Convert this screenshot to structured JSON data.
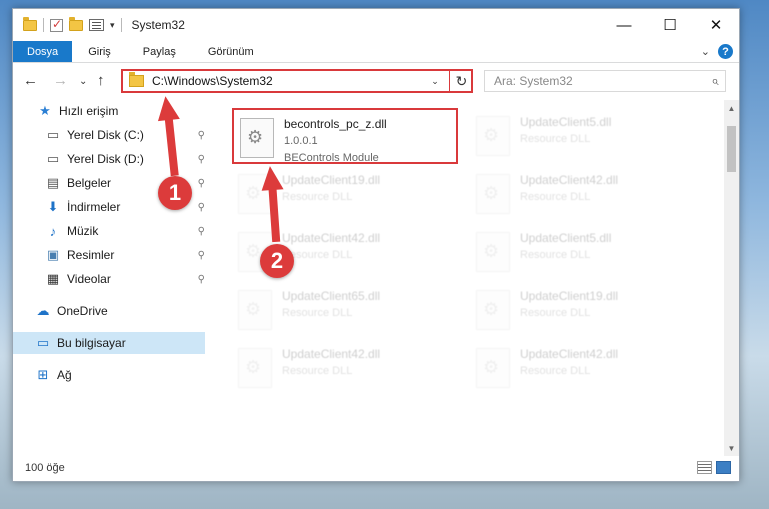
{
  "window": {
    "title": "System32",
    "controls": {
      "minimize": "—",
      "maximize": "☐",
      "close": "✕"
    }
  },
  "ribbon": {
    "tabs": [
      "Dosya",
      "Giriş",
      "Paylaş",
      "Görünüm"
    ],
    "expand_symbol": "⌄",
    "help_symbol": "?"
  },
  "navigation": {
    "back_symbol": "←",
    "forward_symbol": "→",
    "recent_symbol": "⌄",
    "up_symbol": "↑",
    "address_path": "C:\\Windows\\System32",
    "address_drop_symbol": "⌄",
    "refresh_symbol": "↻",
    "search_placeholder": "Ara: System32",
    "search_symbol": "⌕"
  },
  "sidebar": {
    "items": [
      {
        "label": "Hızlı erişim",
        "icon": "star-icon",
        "glyph": "★",
        "color": "#2b7fd4",
        "pinned": false
      },
      {
        "label": "Yerel Disk (C:)",
        "icon": "drive-icon",
        "glyph": "▭",
        "color": "#555555",
        "pinned": true
      },
      {
        "label": "Yerel Disk (D:)",
        "icon": "drive-icon",
        "glyph": "▭",
        "color": "#555555",
        "pinned": true
      },
      {
        "label": "Belgeler",
        "icon": "document-icon",
        "glyph": "▤",
        "color": "#555555",
        "pinned": true
      },
      {
        "label": "İndirmeler",
        "icon": "download-icon",
        "glyph": "⬇",
        "color": "#1e73c8",
        "pinned": true
      },
      {
        "label": "Müzik",
        "icon": "music-icon",
        "glyph": "♪",
        "color": "#1e73c8",
        "pinned": true
      },
      {
        "label": "Resimler",
        "icon": "picture-icon",
        "glyph": "▣",
        "color": "#4a7fb0",
        "pinned": true
      },
      {
        "label": "Videolar",
        "icon": "video-icon",
        "glyph": "▦",
        "color": "#333333",
        "pinned": true
      },
      {
        "label": "OneDrive",
        "icon": "cloud-icon",
        "glyph": "☁",
        "color": "#1e73c8",
        "pinned": false
      },
      {
        "label": "Bu bilgisayar",
        "icon": "computer-icon",
        "glyph": "▭",
        "color": "#1e73c8",
        "pinned": false,
        "selected": true
      },
      {
        "label": "Ağ",
        "icon": "network-icon",
        "glyph": "⊞",
        "color": "#1e73c8",
        "pinned": false
      }
    ],
    "pin_symbol": "⚲"
  },
  "files": [
    {
      "name": "becontrols_pc_z.dll",
      "type": "1.0.0.1",
      "extra": "BEControls Module",
      "highlighted": true
    },
    {
      "name": "UpdateClient5.dll",
      "type": "Resource DLL"
    },
    {
      "name": "UpdateClient19.dll",
      "type": "Resource DLL"
    },
    {
      "name": "UpdateClient42.dll",
      "type": "Resource DLL"
    },
    {
      "name": "UpdateClient42.dll",
      "type": "Resource DLL"
    },
    {
      "name": "UpdateClient5.dll",
      "type": "Resource DLL"
    },
    {
      "name": "UpdateClient65.dll",
      "type": "Resource DLL"
    },
    {
      "name": "UpdateClient19.dll",
      "type": "Resource DLL"
    },
    {
      "name": "UpdateClient42.dll",
      "type": "Resource DLL"
    },
    {
      "name": "UpdateClient42.dll",
      "type": "Resource DLL"
    }
  ],
  "status": {
    "item_count": "100 öğe"
  },
  "annotations": [
    "1",
    "2"
  ],
  "colors": {
    "accent": "#1979ca",
    "annotation": "#dc3b3b"
  }
}
